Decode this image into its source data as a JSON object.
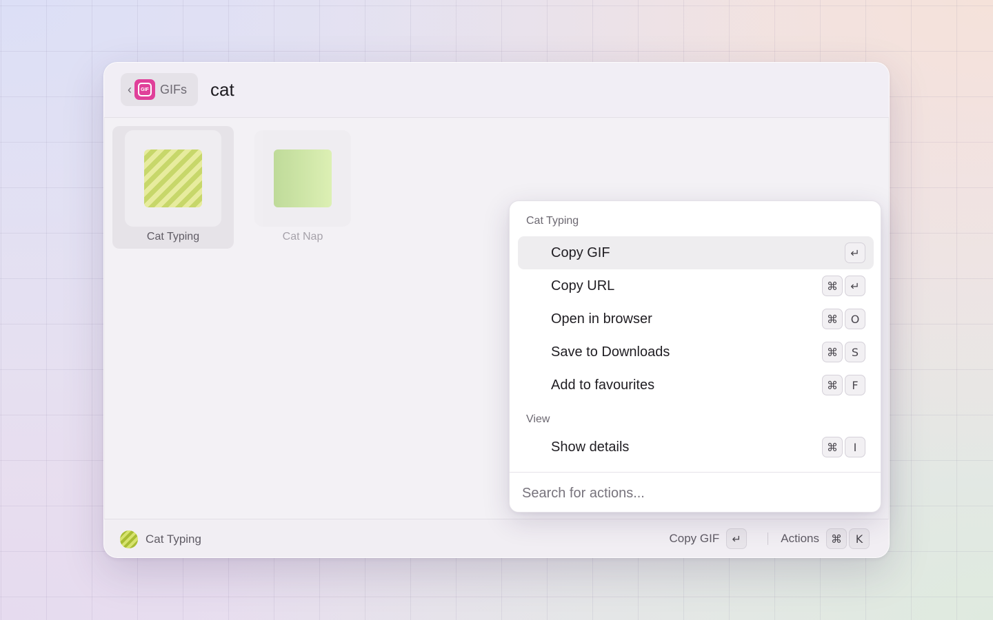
{
  "header": {
    "back_glyph": "‹",
    "extension_icon": "gif-icon",
    "extension_icon_text": "GIF",
    "extension_name": "GIFs",
    "query": "cat"
  },
  "results": [
    {
      "label": "Cat Typing",
      "thumbnail": "striped-lime",
      "selected": true
    },
    {
      "label": "Cat Nap",
      "thumbnail": "gradient-green",
      "selected": false
    }
  ],
  "actions_panel": {
    "sections": [
      {
        "title": "Cat Typing",
        "items": [
          {
            "label": "Copy GIF",
            "keys": [
              "↵"
            ],
            "active": true
          },
          {
            "label": "Copy URL",
            "keys": [
              "⌘",
              "↵"
            ]
          },
          {
            "label": "Open in browser",
            "keys": [
              "⌘",
              "O"
            ]
          },
          {
            "label": "Save to Downloads",
            "keys": [
              "⌘",
              "S"
            ]
          },
          {
            "label": "Add to favourites",
            "keys": [
              "⌘",
              "F"
            ]
          }
        ]
      },
      {
        "title": "View",
        "items": [
          {
            "label": "Show details",
            "keys": [
              "⌘",
              "I"
            ]
          }
        ]
      }
    ],
    "search_placeholder": "Search for actions..."
  },
  "footer": {
    "selected_title": "Cat Typing",
    "primary_action": "Copy GIF",
    "primary_keys": [
      "↵"
    ],
    "actions_label": "Actions",
    "actions_keys": [
      "⌘",
      "K"
    ]
  },
  "colors": {
    "accent_pink": "#e0409a",
    "selection_bg": "#e6e3e8",
    "active_row_bg": "#eeedef"
  }
}
